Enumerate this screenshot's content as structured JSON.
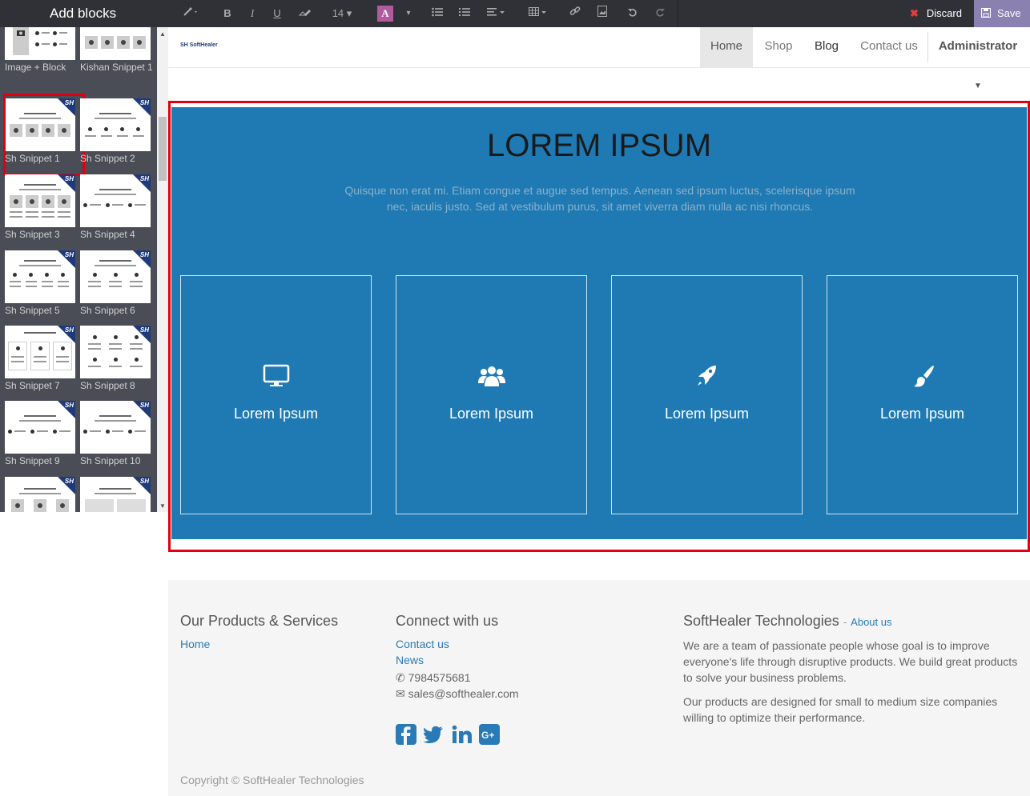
{
  "sidebar": {
    "title": "Add blocks",
    "snippets": [
      {
        "label": "Image + Block"
      },
      {
        "label": "Kishan Snippet 1"
      },
      {
        "label": "Sh Snippet 1",
        "selected": true
      },
      {
        "label": "Sh Snippet 2"
      },
      {
        "label": "Sh Snippet 3"
      },
      {
        "label": "Sh Snippet 4"
      },
      {
        "label": "Sh Snippet 5"
      },
      {
        "label": "Sh Snippet 6"
      },
      {
        "label": "Sh Snippet 7"
      },
      {
        "label": "Sh Snippet 8"
      },
      {
        "label": "Sh Snippet 9"
      },
      {
        "label": "Sh Snippet 10"
      }
    ],
    "badge": "SH"
  },
  "toolbar": {
    "font_size": "14",
    "font_color_letter": "A",
    "bold": "B",
    "italic": "I",
    "underline": "U",
    "discard_label": "Discard",
    "save_label": "Save"
  },
  "site": {
    "logo": "SH SoftHealer",
    "nav": {
      "home": "Home",
      "shop": "Shop",
      "blog": "Blog",
      "contact": "Contact us",
      "admin": "Administrator"
    }
  },
  "hero": {
    "title": "LOREM IPSUM",
    "subtitle": "Quisque non erat mi. Etiam congue et augue sed tempus. Aenean sed ipsum luctus, scelerisque ipsum nec, iaculis justo. Sed at vestibulum purus, sit amet viverra diam nulla ac nisi rhoncus.",
    "cards": [
      {
        "icon": "monitor-icon",
        "title": "Lorem Ipsum"
      },
      {
        "icon": "users-icon",
        "title": "Lorem Ipsum"
      },
      {
        "icon": "rocket-icon",
        "title": "Lorem Ipsum"
      },
      {
        "icon": "paint-brush-icon",
        "title": "Lorem Ipsum"
      }
    ],
    "bg_color": "#1f7ab4"
  },
  "footer": {
    "products_heading": "Our Products & Services",
    "products_home": "Home",
    "connect_heading": "Connect with us",
    "connect_contact": "Contact us",
    "connect_news": "News",
    "phone": "7984575681",
    "email": "sales@softhealer.com",
    "company_heading": "SoftHealer Technologies",
    "about_link": "About us",
    "about_dash": "-",
    "about_p1": "We are a team of passionate people whose goal is to improve everyone's life through disruptive products. We build great products to solve your business problems.",
    "about_p2": "Our products are designed for small to medium size companies willing to optimize their performance.",
    "copyright": "Copyright © SoftHealer Technologies"
  }
}
